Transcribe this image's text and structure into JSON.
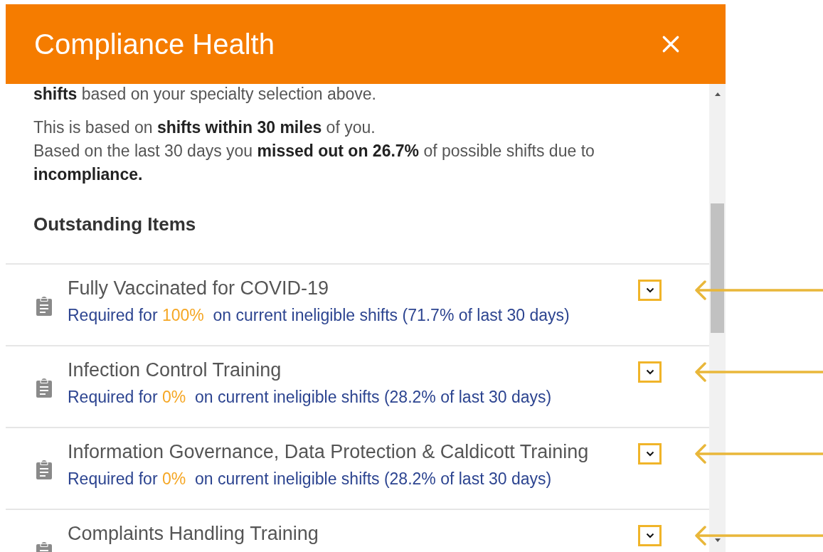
{
  "dialog": {
    "title": "Compliance Health"
  },
  "intro": [
    [
      "**shifts** based on your specialty selection above."
    ],
    [
      "This is based on **shifts within 30 miles** of you.",
      "Based on the last 30 days you **missed out on 26.7%** of possible shifts due to **incompliance.**"
    ]
  ],
  "section_heading": "Outstanding Items",
  "items": [
    {
      "title": "Fully Vaccinated for COVID-19",
      "requirement": {
        "prefix": "Required for",
        "percent": "100%",
        "suffix": "on current ineligible shifts (71.7% of last 30 days)"
      }
    },
    {
      "title": "Infection Control Training",
      "requirement": {
        "prefix": "Required for",
        "percent": "0%",
        "suffix": "on current ineligible shifts (28.2% of last 30 days)"
      }
    },
    {
      "title": "Information Governance, Data Protection & Caldicott Training",
      "requirement": {
        "prefix": "Required for",
        "percent": "0%",
        "suffix": "on current ineligible shifts (28.2% of last 30 days)"
      }
    },
    {
      "title": "Complaints Handling Training"
    }
  ]
}
